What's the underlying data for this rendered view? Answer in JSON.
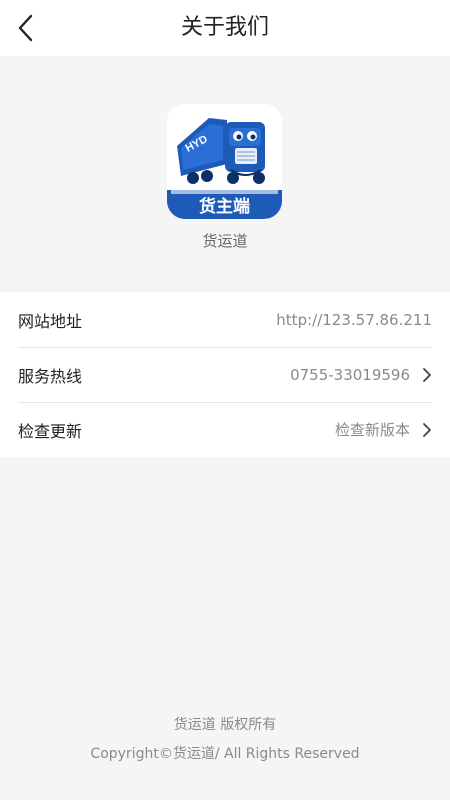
{
  "header": {
    "title": "关于我们"
  },
  "app": {
    "badge": "货主端",
    "logo_text": "HYD",
    "name": "货运道"
  },
  "list": [
    {
      "label": "网站地址",
      "value": "http://123.57.86.211",
      "chevron": false
    },
    {
      "label": "服务热线",
      "value": "0755-33019596",
      "chevron": true
    },
    {
      "label": "检查更新",
      "value": "检查新版本",
      "chevron": true
    }
  ],
  "footer": {
    "line1": "货运道 版权所有",
    "line2": "Copyright©货运道/ All Rights Reserved"
  },
  "colors": {
    "brand_blue": "#1e5bb8",
    "background": "#f5f5f5",
    "text_primary": "#222222",
    "text_secondary": "#8a8a8a"
  }
}
